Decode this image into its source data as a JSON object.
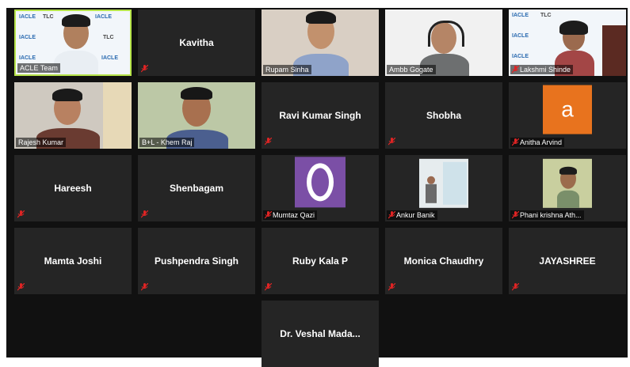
{
  "meeting": {
    "participants": [
      {
        "name": "ACLE Team",
        "video": true,
        "active": true,
        "muted": false
      },
      {
        "name": "Kavitha",
        "video": false,
        "muted": true
      },
      {
        "name": "Rupam Sinha",
        "video": true,
        "muted": false
      },
      {
        "name": "Ambb Gogate",
        "video": true,
        "muted": false
      },
      {
        "name": "Lakshmi Shinde",
        "video": true,
        "muted": true
      },
      {
        "name": "Rajesh Kumar",
        "video": true,
        "muted": false
      },
      {
        "name": "B+L - Khem Raj",
        "video": true,
        "muted": false
      },
      {
        "name": "Ravi Kumar Singh",
        "video": false,
        "muted": true
      },
      {
        "name": "Shobha",
        "video": false,
        "muted": true
      },
      {
        "name": "Anitha Arvind",
        "video": false,
        "avatar_letter": "a",
        "avatar_color": "#e8731e",
        "muted": true
      },
      {
        "name": "Hareesh",
        "video": false,
        "muted": true
      },
      {
        "name": "Shenbagam",
        "video": false,
        "muted": true
      },
      {
        "name": "Mumtaz Qazi",
        "video": false,
        "avatar_letter": "O",
        "avatar_color": "#7b4fa6",
        "muted": true
      },
      {
        "name": "Ankur Banik",
        "video": false,
        "muted": true
      },
      {
        "name": "Phani krishna Ath...",
        "video": false,
        "muted": true
      },
      {
        "name": "Mamta Joshi",
        "video": false,
        "muted": true
      },
      {
        "name": "Pushpendra Singh",
        "video": false,
        "muted": true
      },
      {
        "name": "Ruby Kala P",
        "video": false,
        "muted": true
      },
      {
        "name": "Monica Chaudhry",
        "video": false,
        "muted": true
      },
      {
        "name": "JAYASHREE",
        "video": false,
        "muted": true
      },
      {
        "name": "Dr. Veshal Mada...",
        "video": false,
        "muted": false
      }
    ],
    "banner_text": [
      "IACLE",
      "TLC"
    ],
    "colors": {
      "tile_bg": "#252525",
      "active_border": "#b6e34a",
      "mute_icon": "#e02424"
    }
  }
}
